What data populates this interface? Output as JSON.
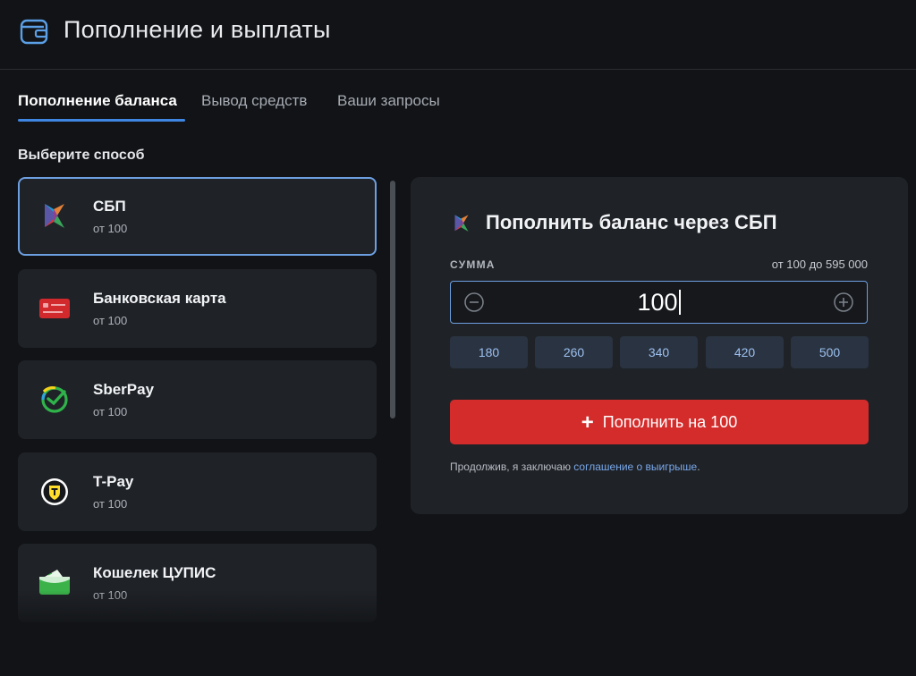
{
  "header": {
    "title": "Пополнение и выплаты",
    "icon": "wallet-icon"
  },
  "tabs": [
    {
      "label": "Пополнение баланса",
      "active": true
    },
    {
      "label": "Вывод средств",
      "active": false
    },
    {
      "label": "Ваши запросы",
      "active": false
    }
  ],
  "methods": {
    "heading": "Выберите способ",
    "items": [
      {
        "name": "СБП",
        "min": "от 100",
        "icon": "sbp-icon",
        "selected": true
      },
      {
        "name": "Банковская карта",
        "min": "от 100",
        "icon": "bank-card-icon",
        "selected": false
      },
      {
        "name": "SberPay",
        "min": "от 100",
        "icon": "sberpay-icon",
        "selected": false
      },
      {
        "name": "T-Pay",
        "min": "от 100",
        "icon": "tpay-icon",
        "selected": false
      },
      {
        "name": "Кошелек ЦУПИС",
        "min": "от 100",
        "icon": "cupis-wallet-icon",
        "selected": false
      }
    ]
  },
  "panel": {
    "title": "Пополнить баланс через СБП",
    "amount_label": "СУММА",
    "range": "от 100 до 595 000",
    "amount": "100",
    "presets": [
      "180",
      "260",
      "340",
      "420",
      "500"
    ],
    "submit_label": "Пополнить на 100",
    "agreement_prefix": "Продолжив, я заключаю ",
    "agreement_link": "соглашение о выигрыше",
    "agreement_suffix": "."
  },
  "colors": {
    "background": "#111316",
    "card": "#1f2227",
    "accent": "#3e86e2",
    "selected_border": "#6d9fe0",
    "submit": "#d42b2b",
    "preset_bg": "#2a3341",
    "preset_text": "#9cc0ef"
  }
}
